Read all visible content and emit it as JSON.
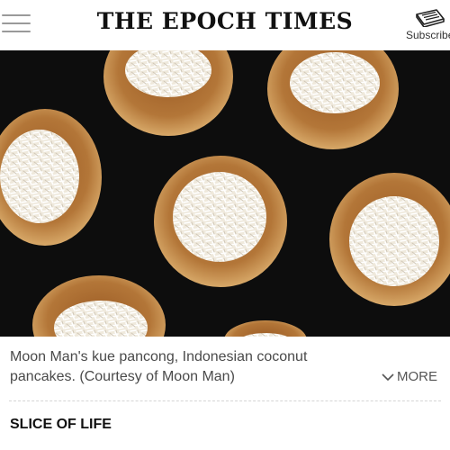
{
  "header": {
    "menu_icon": "hamburger-menu-icon",
    "masthead": "THE EPOCH TIMES",
    "subscribe_icon": "newspaper-icon",
    "subscribe_label": "Subscribe"
  },
  "photo": {
    "subject": "Moon Man's kue pancong, Indonesian coconut pancakes"
  },
  "caption": {
    "text": "Moon Man's kue pancong, Indonesian coconut pancakes. (Courtesy of Moon Man)",
    "more_label": "MORE",
    "more_icon": "chevron-down-icon"
  },
  "section": {
    "label": "SLICE OF LIFE"
  },
  "colors": {
    "photo_background": "#0d0d0d",
    "pancake": "#c08a45",
    "coconut": "#f3efe6"
  }
}
